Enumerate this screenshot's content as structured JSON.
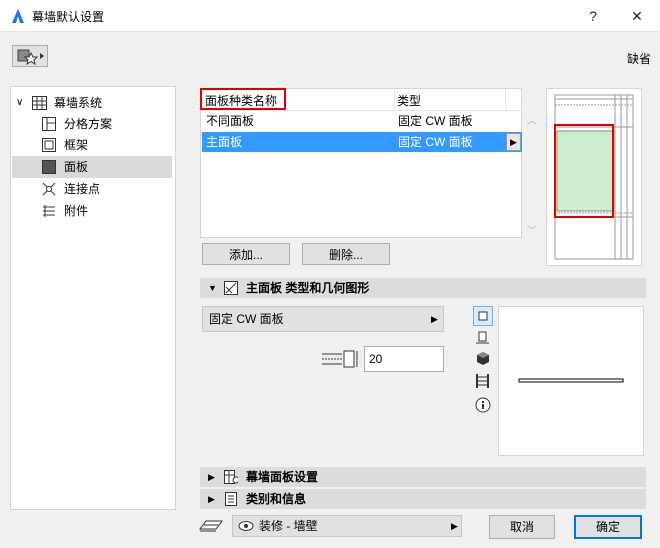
{
  "window": {
    "title": "幕墙默认设置",
    "help": "?",
    "close": "✕"
  },
  "header": {
    "default_label": "缺省"
  },
  "tree": {
    "root": "幕墙系统",
    "items": [
      {
        "label": "分格方案",
        "icon": "grid-scheme-icon"
      },
      {
        "label": "框架",
        "icon": "frame-icon"
      },
      {
        "label": "面板",
        "icon": "panel-icon",
        "selected": true
      },
      {
        "label": "连接点",
        "icon": "junction-icon"
      },
      {
        "label": "附件",
        "icon": "accessory-icon"
      }
    ]
  },
  "table": {
    "columns": [
      "面板种类名称",
      "类型"
    ],
    "rows": [
      {
        "name": "不同面板",
        "type": "固定 CW 面板"
      },
      {
        "name": "主面板",
        "type": "固定 CW 面板",
        "selected": true
      }
    ]
  },
  "buttons": {
    "add": "添加...",
    "delete": "删除...",
    "cancel": "取消",
    "ok": "确定"
  },
  "sections": {
    "main": "主面板 类型和几何图形",
    "settings": "幕墙面板设置",
    "category": "类别和信息"
  },
  "panel_type": {
    "selected": "固定 CW 面板"
  },
  "thickness": {
    "value": "20"
  },
  "footer": {
    "layer_value": "装修 - 墙壁"
  }
}
